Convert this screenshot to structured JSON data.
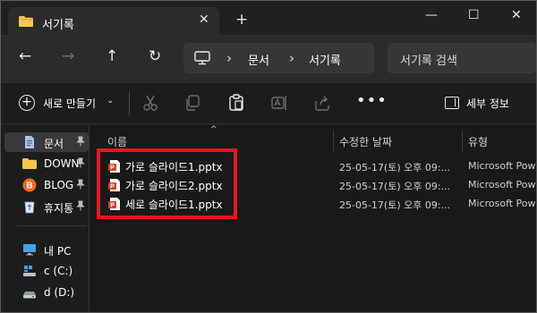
{
  "window": {
    "tab_title": "서기록",
    "tab_close": "✕",
    "new_tab": "+",
    "minimize": "—",
    "maximize": "☐",
    "close": "✕"
  },
  "nav": {
    "back": "←",
    "forward": "→",
    "up": "↑",
    "refresh": "↻",
    "breadcrumbs": [
      "문서",
      "서기록"
    ],
    "separator": "›",
    "search_placeholder": "서기록 검색"
  },
  "commandbar": {
    "new_label": "새로 만들기",
    "new_dropdown": "⌄",
    "more": "•••",
    "details_label": "세부 정보"
  },
  "sidebar": {
    "items": [
      {
        "label": "문서",
        "icon": "document-icon",
        "pinned": true,
        "selected": true
      },
      {
        "label": "DOWN",
        "icon": "folder-icon",
        "pinned": true
      },
      {
        "label": "BLOG",
        "icon": "blog-icon",
        "pinned": true
      },
      {
        "label": "휴지통",
        "icon": "recycle-bin-icon",
        "pinned": true
      },
      {
        "label": "내 PC",
        "icon": "pc-icon"
      },
      {
        "label": "c (C:)",
        "icon": "drive-icon"
      },
      {
        "label": "d (D:)",
        "icon": "drive-icon"
      }
    ],
    "pin_glyph": "📌"
  },
  "content": {
    "columns": [
      "이름",
      "수정한 날짜",
      "유형"
    ],
    "sort_glyph": "^",
    "files": [
      {
        "name": "가로 슬라이드1.pptx",
        "modified": "25-05-17(토) 오후 09:...",
        "type": "Microsoft Powe"
      },
      {
        "name": "가로 슬라이드2.pptx",
        "modified": "25-05-17(토) 오후 09:...",
        "type": "Microsoft Powe"
      },
      {
        "name": "세로 슬라이드1.pptx",
        "modified": "25-05-17(토) 오후 09:...",
        "type": "Microsoft Powe"
      }
    ]
  },
  "colors": {
    "highlight_border": "#e8141e",
    "folder": "#f2c84b",
    "ppt": "#d04423"
  }
}
